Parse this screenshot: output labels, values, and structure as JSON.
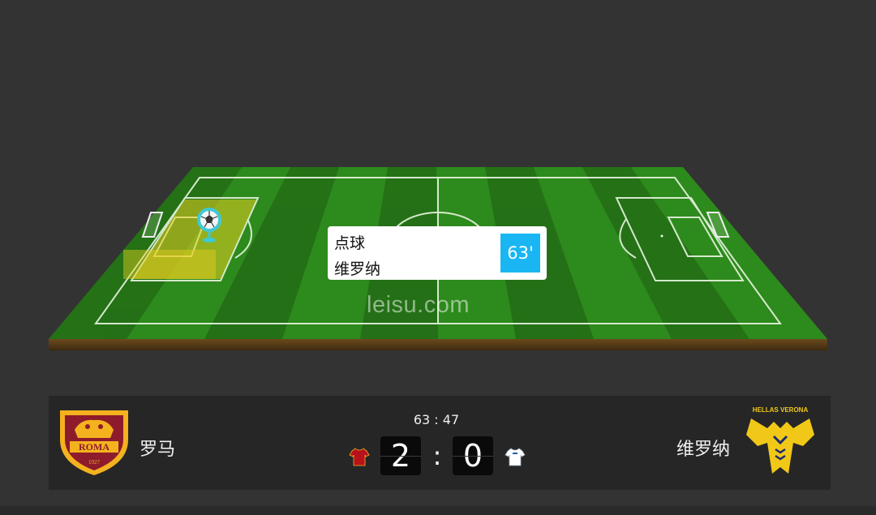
{
  "watermark": "leisu.com",
  "event": {
    "type": "点球",
    "team": "维罗纳",
    "minute": "63'"
  },
  "match": {
    "time": "63 : 47",
    "home": {
      "name": "罗马",
      "score": "2",
      "shirt_color": "#b5121b",
      "logo_text": "ROMA",
      "logo_year": "1927"
    },
    "away": {
      "name": "维罗纳",
      "score": "0",
      "shirt_color": "#ffffff",
      "logo_text": "HELLAS VERONA"
    },
    "score_separator": ":"
  },
  "colors": {
    "background": "#333333",
    "pitch": "#2f8f1f",
    "minute_badge": "#19b6f3",
    "highlight_zone": "#e8d020"
  },
  "icons": {
    "ball_marker": "soccer-ball-pin-icon",
    "home_shirt": "jersey-icon",
    "away_shirt": "jersey-icon"
  }
}
